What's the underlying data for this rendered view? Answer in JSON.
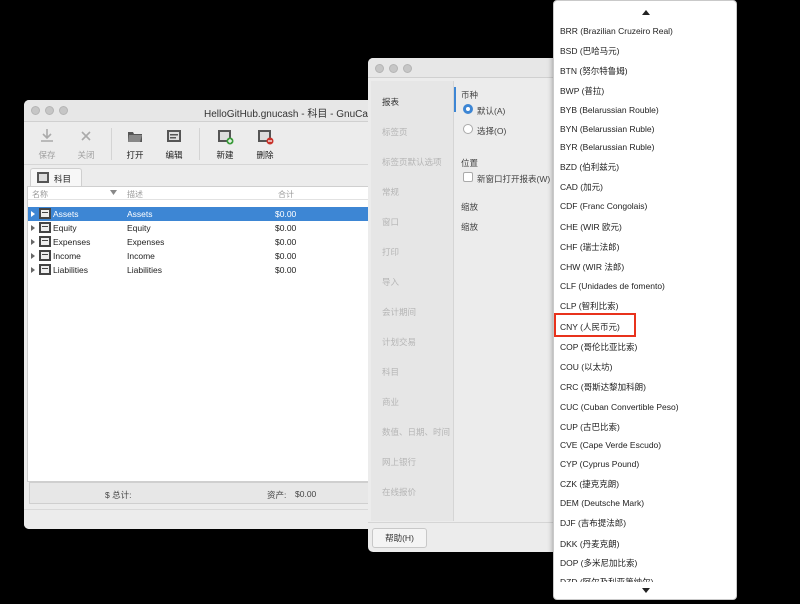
{
  "main_window": {
    "title": "HelloGitHub.gnucash - 科目 - GnuCash",
    "toolbar": [
      {
        "label": "保存",
        "icon": "save-icon",
        "enabled": false
      },
      {
        "label": "关闭",
        "icon": "close-icon",
        "enabled": false
      },
      {
        "label": "打开",
        "icon": "open-folder-icon",
        "enabled": true
      },
      {
        "label": "编辑",
        "icon": "edit-icon",
        "enabled": true
      },
      {
        "label": "新建",
        "icon": "new-account-icon",
        "enabled": true
      },
      {
        "label": "删除",
        "icon": "delete-account-icon",
        "enabled": true
      }
    ],
    "tab_label": "科目",
    "columns": {
      "name": "名称",
      "description": "描述",
      "total": "合计"
    },
    "accounts": [
      {
        "name": "Assets",
        "description": "Assets",
        "total": "$0.00",
        "selected": true
      },
      {
        "name": "Equity",
        "description": "Equity",
        "total": "$0.00",
        "selected": false
      },
      {
        "name": "Expenses",
        "description": "Expenses",
        "total": "$0.00",
        "selected": false
      },
      {
        "name": "Income",
        "description": "Income",
        "total": "$0.00",
        "selected": false
      },
      {
        "name": "Liabilities",
        "description": "Liabilities",
        "total": "$0.00",
        "selected": false
      }
    ],
    "summary": {
      "total_label": "$ 总计:",
      "assets_label": "资产:",
      "assets_value": "$0.00"
    }
  },
  "prefs_window": {
    "sidebar": [
      "报表",
      "标签页",
      "标签页默认选项",
      "常规",
      "窗口",
      "打印",
      "导入",
      "会计期间",
      "计划交易",
      "科目",
      "商业",
      "数值、日期、时间",
      "网上银行",
      "在线报价"
    ],
    "active_sidebar": "报表",
    "currency_heading": "币种",
    "radio_default": "默认(A)",
    "radio_choose": "选择(O)",
    "position_heading": "位置",
    "new_window_checkbox": "新窗口打开报表(W)",
    "zoom_heading": "缩放",
    "zoom_label": "缩放",
    "help_button": "帮助(H)"
  },
  "currency_list": {
    "items": [
      "BRR (Brazilian Cruzeiro Real)",
      "BSD (巴哈马元)",
      "BTN (努尔特鲁姆)",
      "BWP (普拉)",
      "BYB (Belarussian Rouble)",
      "BYN (Belarussian Ruble)",
      "BYR (Belarussian Ruble)",
      "BZD (伯利兹元)",
      "CAD (加元)",
      "CDF (Franc Congolais)",
      "CHE (WIR 欧元)",
      "CHF (瑞士法郎)",
      "CHW (WIR 法郎)",
      "CLF (Unidades de fomento)",
      "CLP (智利比索)",
      "CNY (人民币元)",
      "COP (哥伦比亚比索)",
      "COU (以太坊)",
      "CRC (哥斯达黎加科朗)",
      "CUC (Cuban Convertible Peso)",
      "CUP (古巴比索)",
      "CVE (Cape Verde Escudo)",
      "CYP (Cyprus Pound)",
      "CZK (捷克克朗)",
      "DEM (Deutsche Mark)",
      "DJF (吉布提法郎)",
      "DKK (丹麦克朗)",
      "DOP (多米尼加比索)",
      "DZD (阿尔及利亚第纳尔)"
    ],
    "highlighted": "CNY (人民币元)"
  }
}
